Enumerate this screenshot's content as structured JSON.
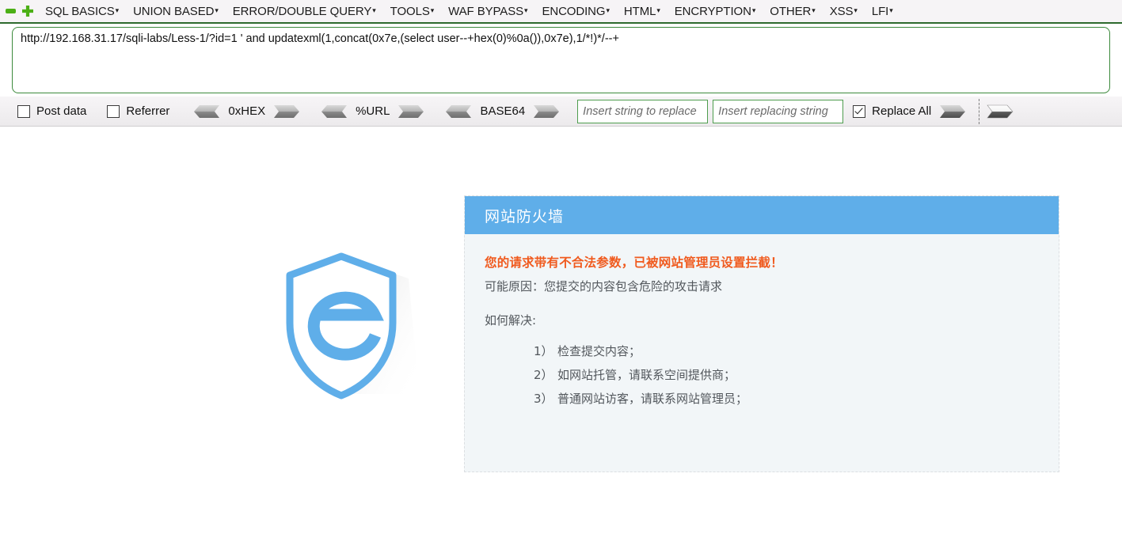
{
  "menubar": {
    "icons": [
      {
        "name": "remove-icon"
      },
      {
        "name": "add-icon"
      }
    ],
    "items": [
      {
        "label": "SQL BASICS",
        "caret": "▾"
      },
      {
        "label": "UNION BASED",
        "caret": "▾"
      },
      {
        "label": "ERROR/DOUBLE QUERY",
        "caret": "▾"
      },
      {
        "label": "TOOLS",
        "caret": "▾"
      },
      {
        "label": "WAF BYPASS",
        "caret": "▾"
      },
      {
        "label": "ENCODING",
        "caret": "▾"
      },
      {
        "label": "HTML",
        "caret": "▾"
      },
      {
        "label": "ENCRYPTION",
        "caret": "▾"
      },
      {
        "label": "OTHER",
        "caret": "▾"
      },
      {
        "label": "XSS",
        "caret": "▾"
      },
      {
        "label": "LFI",
        "caret": "▾"
      }
    ]
  },
  "url_field": {
    "value": "http://192.168.31.17/sqli-labs/Less-1/?id=1 ' and updatexml(1,concat(0x7e,(select user--+hex(0)%0a()),0x7e),1/*!)*/--+",
    "before_caret": "http://192.168.31.17/sqli-labs/Less-1/?id=1 ' and updatexml(1,concat(0x7e,(select user--+hex(0)%0a",
    "after_caret": "()),0x7e),1/*!)*/--+"
  },
  "toolbar": {
    "post_data": {
      "label": "Post data",
      "checked": false
    },
    "referrer": {
      "label": "Referrer",
      "checked": false
    },
    "encoders": [
      {
        "label": "0xHEX",
        "decode_icon": "arrow-left-icon",
        "encode_icon": "arrow-right-icon"
      },
      {
        "label": "%URL",
        "decode_icon": "arrow-left-icon",
        "encode_icon": "arrow-right-icon"
      },
      {
        "label": "BASE64",
        "decode_icon": "arrow-left-icon",
        "encode_icon": "arrow-right-icon"
      }
    ],
    "search_input": {
      "value": "",
      "placeholder": "Insert string to replace"
    },
    "replace_input": {
      "value": "",
      "placeholder": "Insert replacing string"
    },
    "replace_all": {
      "label": "Replace All",
      "checked": true
    },
    "replace_button_icon": "arrow-right-icon",
    "send_button_icon": "arrow-right-outline-icon"
  },
  "shield": {
    "icon": "shield-e-logo",
    "color": "#5FAEE9"
  },
  "panel": {
    "title": "网站防火墙",
    "header_color": "#5FAEE9",
    "alert_color": "#F05A1E",
    "alert_title": "您的请求带有不合法参数，已被网站管理员设置拦截！",
    "reason": "可能原因：您提交的内容包含危险的攻击请求",
    "howto_label": "如何解决:",
    "steps": [
      {
        "num": "1）",
        "text": "检查提交内容；"
      },
      {
        "num": "2）",
        "text": "如网站托管，请联系空间提供商；"
      },
      {
        "num": "3）",
        "text": "普通网站访客，请联系网站管理员；"
      }
    ]
  }
}
